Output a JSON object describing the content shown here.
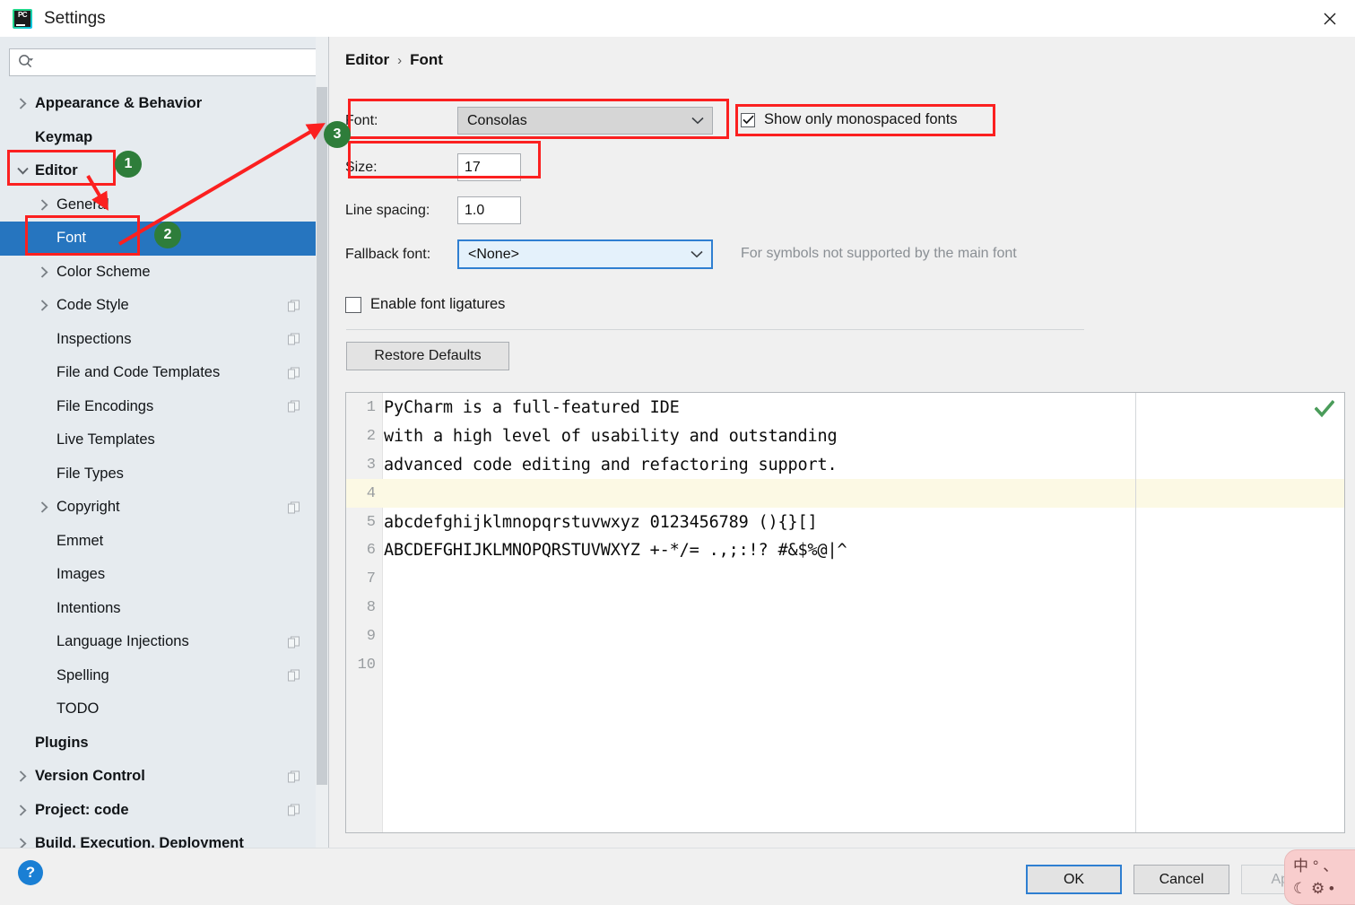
{
  "window": {
    "title": "Settings",
    "app_icon": "pycharm-icon",
    "close_icon": "close-icon"
  },
  "search": {
    "placeholder": "",
    "value": "",
    "icon": "search-icon"
  },
  "sidebar": {
    "items": [
      {
        "label": "Appearance & Behavior",
        "level": 0,
        "chevron": "right",
        "bold": true,
        "selected": false,
        "copy_badge": false
      },
      {
        "label": "Keymap",
        "level": 0,
        "chevron": "none",
        "bold": true,
        "selected": false,
        "copy_badge": false
      },
      {
        "label": "Editor",
        "level": 0,
        "chevron": "down",
        "bold": true,
        "selected": false,
        "copy_badge": false
      },
      {
        "label": "General",
        "level": 1,
        "chevron": "right",
        "bold": false,
        "selected": false,
        "copy_badge": false
      },
      {
        "label": "Font",
        "level": 1,
        "chevron": "none",
        "bold": false,
        "selected": true,
        "copy_badge": false
      },
      {
        "label": "Color Scheme",
        "level": 1,
        "chevron": "right",
        "bold": false,
        "selected": false,
        "copy_badge": false
      },
      {
        "label": "Code Style",
        "level": 1,
        "chevron": "right",
        "bold": false,
        "selected": false,
        "copy_badge": true
      },
      {
        "label": "Inspections",
        "level": 1,
        "chevron": "none",
        "bold": false,
        "selected": false,
        "copy_badge": true
      },
      {
        "label": "File and Code Templates",
        "level": 1,
        "chevron": "none",
        "bold": false,
        "selected": false,
        "copy_badge": true
      },
      {
        "label": "File Encodings",
        "level": 1,
        "chevron": "none",
        "bold": false,
        "selected": false,
        "copy_badge": true
      },
      {
        "label": "Live Templates",
        "level": 1,
        "chevron": "none",
        "bold": false,
        "selected": false,
        "copy_badge": false
      },
      {
        "label": "File Types",
        "level": 1,
        "chevron": "none",
        "bold": false,
        "selected": false,
        "copy_badge": false
      },
      {
        "label": "Copyright",
        "level": 1,
        "chevron": "right",
        "bold": false,
        "selected": false,
        "copy_badge": true
      },
      {
        "label": "Emmet",
        "level": 1,
        "chevron": "none",
        "bold": false,
        "selected": false,
        "copy_badge": false
      },
      {
        "label": "Images",
        "level": 1,
        "chevron": "none",
        "bold": false,
        "selected": false,
        "copy_badge": false
      },
      {
        "label": "Intentions",
        "level": 1,
        "chevron": "none",
        "bold": false,
        "selected": false,
        "copy_badge": false
      },
      {
        "label": "Language Injections",
        "level": 1,
        "chevron": "none",
        "bold": false,
        "selected": false,
        "copy_badge": true
      },
      {
        "label": "Spelling",
        "level": 1,
        "chevron": "none",
        "bold": false,
        "selected": false,
        "copy_badge": true
      },
      {
        "label": "TODO",
        "level": 1,
        "chevron": "none",
        "bold": false,
        "selected": false,
        "copy_badge": false
      },
      {
        "label": "Plugins",
        "level": 0,
        "chevron": "none",
        "bold": true,
        "selected": false,
        "copy_badge": false
      },
      {
        "label": "Version Control",
        "level": 0,
        "chevron": "right",
        "bold": true,
        "selected": false,
        "copy_badge": true
      },
      {
        "label": "Project: code",
        "level": 0,
        "chevron": "right",
        "bold": true,
        "selected": false,
        "copy_badge": true
      },
      {
        "label": "Build, Execution, Deployment",
        "level": 0,
        "chevron": "right",
        "bold": true,
        "selected": false,
        "copy_badge": false
      }
    ]
  },
  "breadcrumb": {
    "parent": "Editor",
    "separator": "›",
    "current": "Font"
  },
  "form": {
    "font_label": "Font:",
    "font_value": "Consolas",
    "size_label": "Size:",
    "size_value": "17",
    "line_spacing_label": "Line spacing:",
    "line_spacing_value": "1.0",
    "fallback_label": "Fallback font:",
    "fallback_value": "<None>",
    "fallback_hint": "For symbols not supported by the main font",
    "monospaced_label": "Show only monospaced fonts",
    "monospaced_checked": true,
    "ligatures_label": "Enable font ligatures",
    "ligatures_checked": false,
    "restore_defaults_label": "Restore Defaults"
  },
  "preview": {
    "inspection_icon": "green-check-icon",
    "highlighted_line": 4,
    "lines": [
      {
        "num": "1",
        "text": "PyCharm is a full-featured IDE"
      },
      {
        "num": "2",
        "text": "with a high level of usability and outstanding"
      },
      {
        "num": "3",
        "text": "advanced code editing and refactoring support."
      },
      {
        "num": "4",
        "text": ""
      },
      {
        "num": "5",
        "text": "abcdefghijklmnopqrstuvwxyz 0123456789 (){}[]"
      },
      {
        "num": "6",
        "text": "ABCDEFGHIJKLMNOPQRSTUVWXYZ +-*/= .,;:!? #&$%@|^"
      },
      {
        "num": "7",
        "text": ""
      },
      {
        "num": "8",
        "text": ""
      },
      {
        "num": "9",
        "text": ""
      },
      {
        "num": "10",
        "text": ""
      }
    ]
  },
  "footer": {
    "help_label": "?",
    "ok_label": "OK",
    "cancel_label": "Cancel",
    "apply_label": "Apply",
    "apply_disabled": true
  },
  "ime": {
    "row1": "中 ° 、",
    "row2": "☾ ⚙ •"
  },
  "annotations": {
    "badge1": "1",
    "badge2": "2",
    "badge3": "3",
    "accent_red": "#fb2020",
    "accent_green": "#2e7d3a",
    "selection_blue": "#2675bf"
  }
}
